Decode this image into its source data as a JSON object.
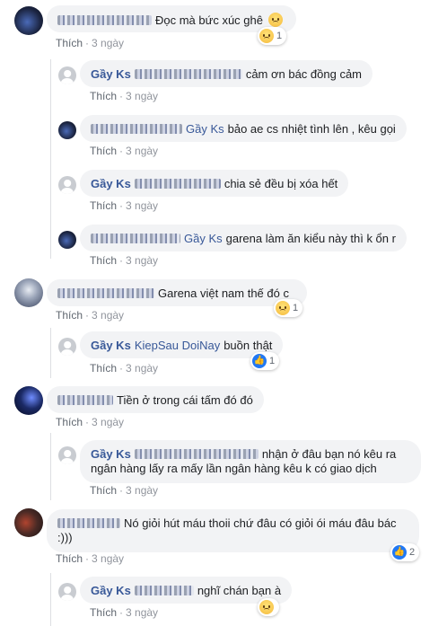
{
  "comments": [
    {
      "name": "",
      "text": "Đọc mà bức xúc ghê",
      "like": "Thích",
      "time": "3 ngày",
      "reaction_count": "1"
    },
    {
      "name": "Gầy Ks",
      "text": "cảm ơn bác đồng cảm",
      "like": "Thích",
      "time": "3 ngày"
    },
    {
      "name": "Gầy Ks",
      "text": "bảo ae cs nhiệt tình lên , kêu gọi",
      "like": "Thích",
      "time": "3 ngày"
    },
    {
      "name": "Gầy Ks",
      "text": "chia sẻ đều bị xóa hết",
      "like": "Thích",
      "time": "3 ngày"
    },
    {
      "name": "Gầy Ks",
      "text": "garena làm ăn kiểu này thì k ổn r",
      "like": "Thích",
      "time": "3 ngày"
    },
    {
      "name": "",
      "text": "Garena việt nam thế đó c",
      "like": "Thích",
      "time": "3 ngày",
      "reaction_count": "1"
    },
    {
      "name": "Gầy Ks",
      "tag": "KiepSau DoiNay",
      "text": "buồn thật",
      "like": "Thích",
      "time": "3 ngày",
      "reaction_count": "1"
    },
    {
      "name": "",
      "text": "Tiền ở trong cái tấm đó đó",
      "like": "Thích",
      "time": "3 ngày"
    },
    {
      "name": "Gầy Ks",
      "text": "nhận ở đâu bạn nó kêu ra ngân hàng lấy ra mấy lần ngân hàng kêu k có giao dịch",
      "like": "Thích",
      "time": "3 ngày"
    },
    {
      "name": "",
      "text": "Nó giỏi hút máu thoii chứ đâu có giỏi ói máu đâu bác :)))",
      "like": "Thích",
      "time": "3 ngày",
      "reaction_count": "2"
    },
    {
      "name": "Gầy Ks",
      "text": "nghĩ chán bạn à",
      "like": "Thích",
      "time": "3 ngày"
    }
  ],
  "mentions": [
    "Gầy Ks",
    "Gầy Ks"
  ],
  "icons": {
    "reaction_sad": "sad-face-icon",
    "reaction_like": "thumbs-up-icon",
    "avatar_default": "default-avatar-icon"
  },
  "colors": {
    "name": "#385898",
    "bubble": "#f2f3f5",
    "meta": "#90949c"
  }
}
